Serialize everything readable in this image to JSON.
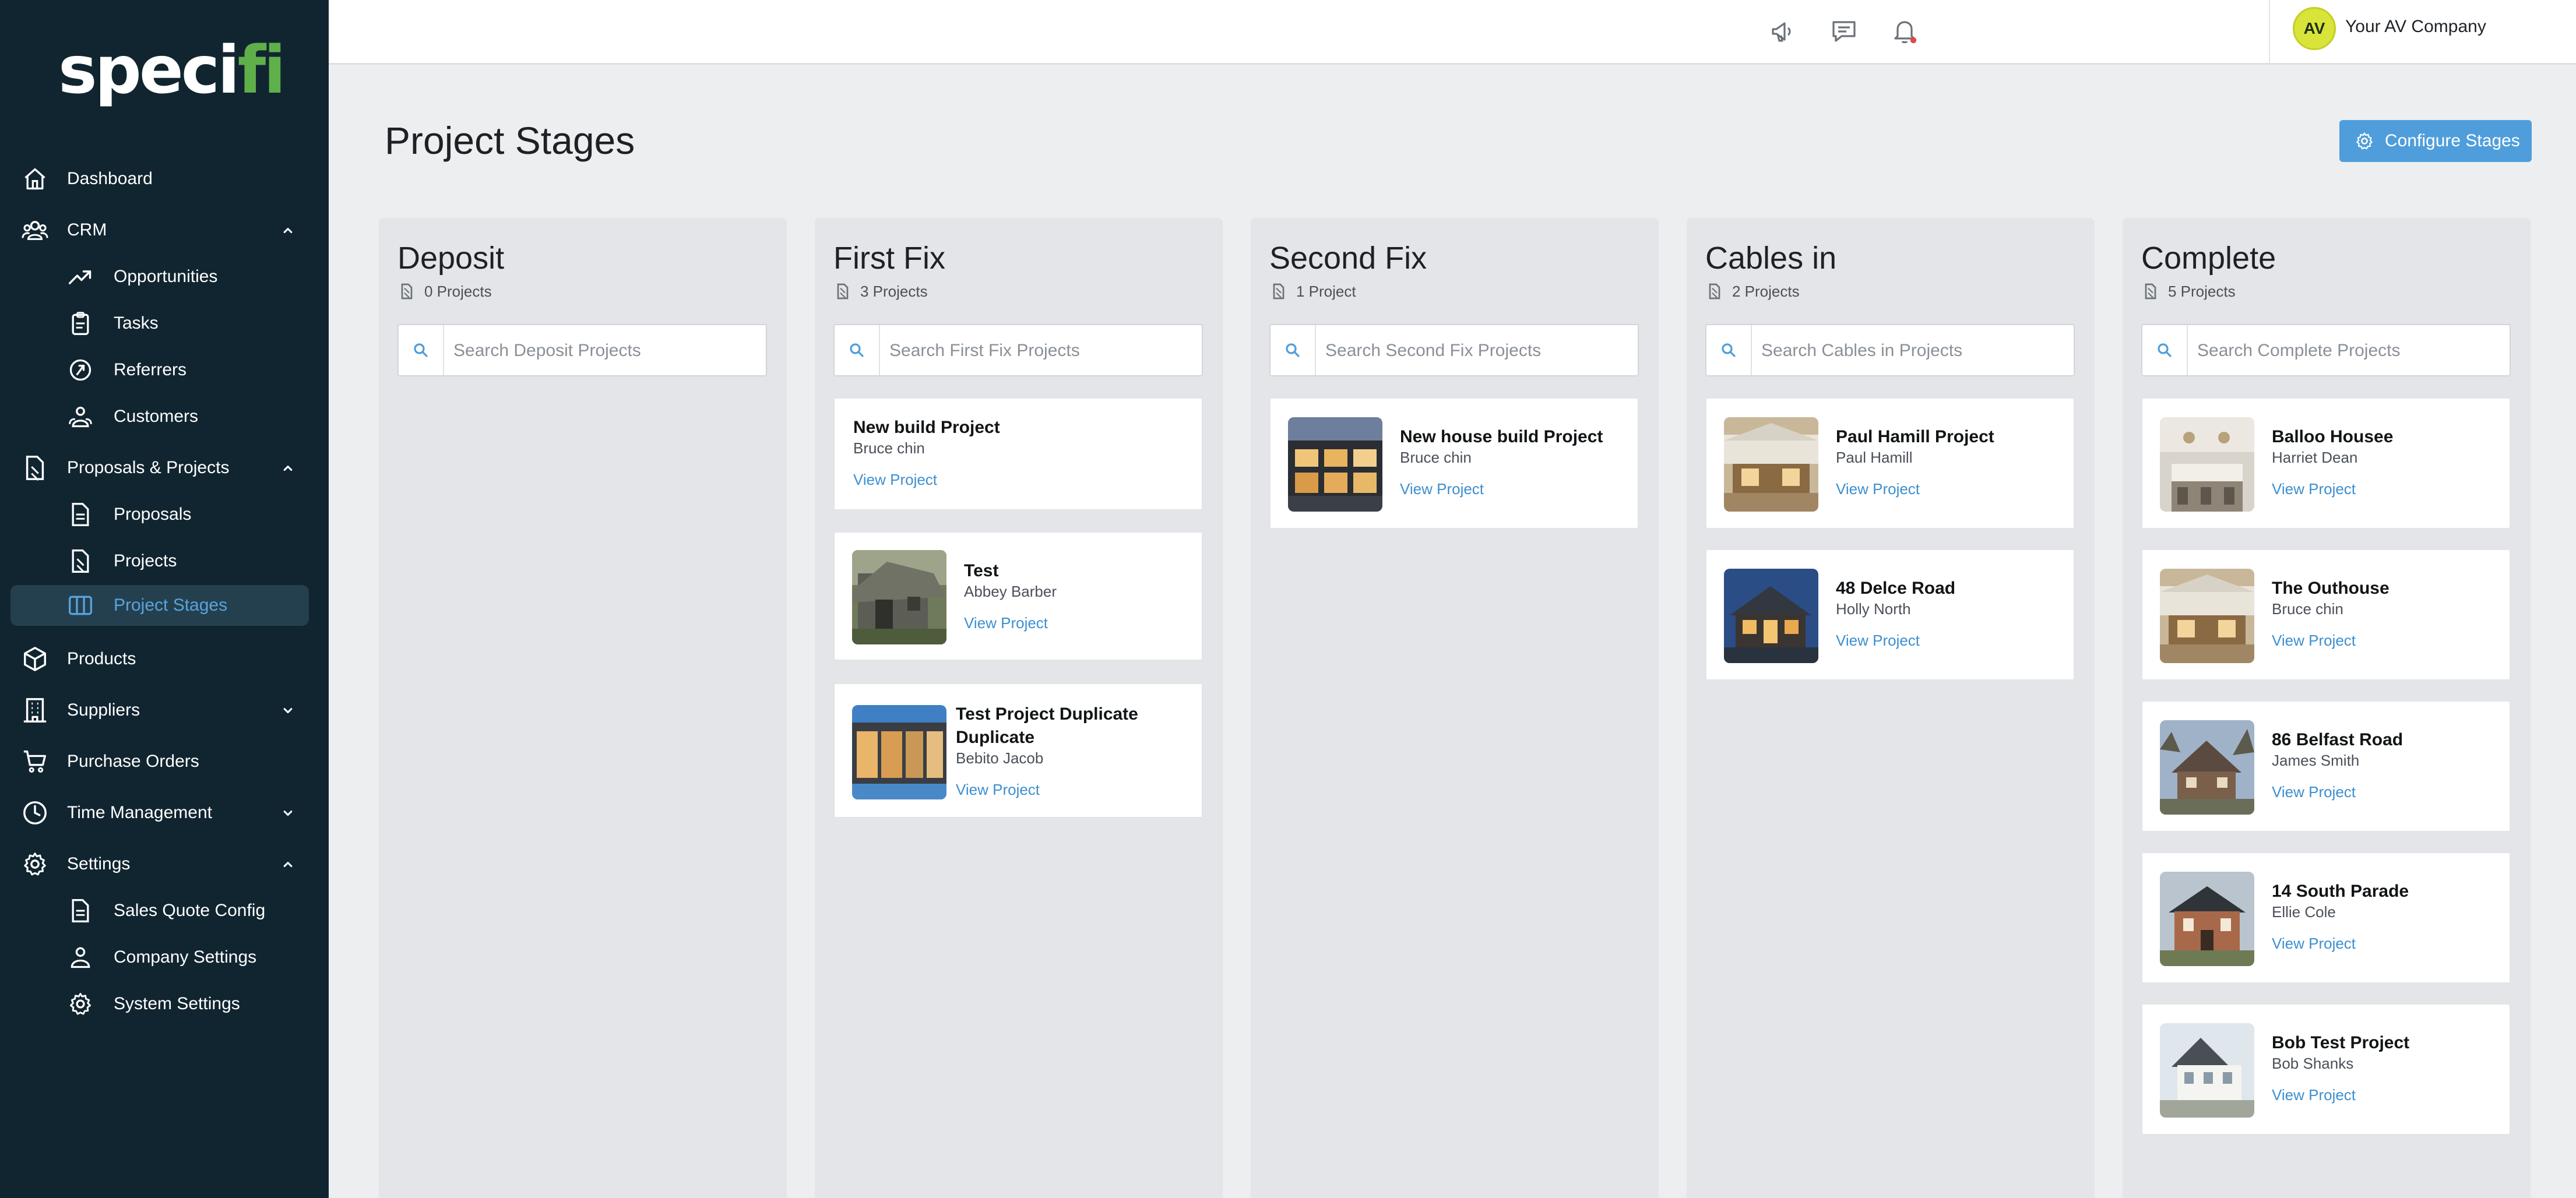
{
  "logo": {
    "text_main": "speci",
    "text_accent": "fi"
  },
  "sidebar": {
    "items": [
      {
        "label": "Dashboard"
      },
      {
        "label": "CRM"
      },
      {
        "label": "Opportunities"
      },
      {
        "label": "Tasks"
      },
      {
        "label": "Referrers"
      },
      {
        "label": "Customers"
      },
      {
        "label": "Proposals & Projects"
      },
      {
        "label": "Proposals"
      },
      {
        "label": "Projects"
      },
      {
        "label": "Project Stages"
      },
      {
        "label": "Products"
      },
      {
        "label": "Suppliers"
      },
      {
        "label": "Purchase Orders"
      },
      {
        "label": "Time Management"
      },
      {
        "label": "Settings"
      },
      {
        "label": "Sales Quote Config"
      },
      {
        "label": "Company Settings"
      },
      {
        "label": "System Settings"
      }
    ]
  },
  "header": {
    "avatar_initials": "AV",
    "company_name": "Your AV Company",
    "icons": [
      "megaphone-icon",
      "chat-icon",
      "bell-icon"
    ],
    "notification_dot_color": "#e0484b"
  },
  "page": {
    "title": "Project Stages",
    "configure_button": "Configure Stages"
  },
  "colors": {
    "sidebar_bg": "#112530",
    "accent": "#4f9edb",
    "link": "#3c8fd0",
    "active_nav": "#5aa3dc"
  },
  "columns": [
    {
      "title": "Deposit",
      "count": "0 Projects",
      "search_placeholder": "Search Deposit Projects",
      "cards": []
    },
    {
      "title": "First Fix",
      "count": "3 Projects",
      "search_placeholder": "Search First Fix Projects",
      "cards": [
        {
          "title": "New build Project",
          "owner": "Bruce chin",
          "link": "View Project"
        },
        {
          "title": "Test",
          "owner": "Abbey Barber",
          "link": "View Project"
        },
        {
          "title": "Test Project Duplicate",
          "title2": "Duplicate",
          "owner": "Bebito Jacob",
          "link": "View Project"
        }
      ]
    },
    {
      "title": "Second Fix",
      "count": "1 Project",
      "search_placeholder": "Search Second Fix Projects",
      "cards": [
        {
          "title": "New house build Project",
          "owner": "Bruce chin",
          "link": "View Project"
        }
      ]
    },
    {
      "title": "Cables in",
      "count": "2 Projects",
      "search_placeholder": "Search Cables in Projects",
      "cards": [
        {
          "title": "Paul Hamill Project",
          "owner": "Paul Hamill",
          "link": "View Project"
        },
        {
          "title": "48 Delce Road",
          "owner": "Holly North",
          "link": "View Project"
        }
      ]
    },
    {
      "title": "Complete",
      "count": "5 Projects",
      "search_placeholder": "Search Complete Projects",
      "cards": [
        {
          "title": "Balloo Housee",
          "owner": "Harriet Dean",
          "link": "View Project"
        },
        {
          "title": "The Outhouse",
          "owner": "Bruce chin",
          "link": "View Project"
        },
        {
          "title": "86 Belfast Road",
          "owner": "James Smith",
          "link": "View Project"
        },
        {
          "title": "14 South Parade",
          "owner": "Ellie Cole",
          "link": "View Project"
        },
        {
          "title": "Bob Test Project",
          "owner": "Bob Shanks",
          "link": "View Project"
        }
      ]
    }
  ]
}
